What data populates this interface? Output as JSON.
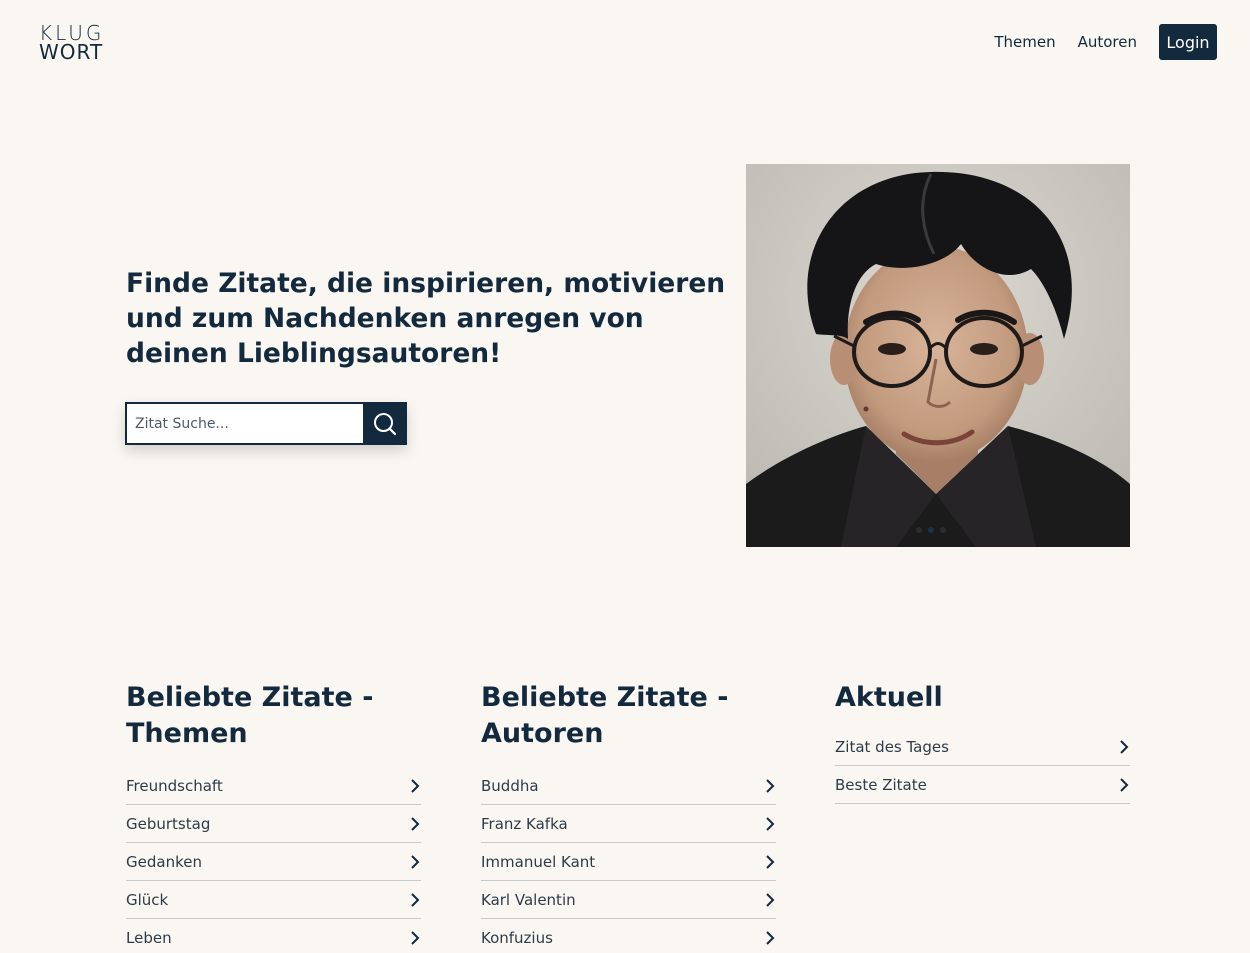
{
  "header": {
    "logo_line1": "KLUG",
    "logo_line2": "WORT",
    "nav": [
      "Themen",
      "Autoren"
    ],
    "login_label": "Login"
  },
  "hero": {
    "title": "Finde Zitate, die inspirieren, motivieren und zum Nachdenken anregen von deinen Lieblingsautoren!",
    "search_placeholder": "Zitat Suche...",
    "search_icon": "search-icon",
    "image": "author-portrait"
  },
  "columns": [
    {
      "heading": "Beliebte Zitate - Themen",
      "items": [
        "Freundschaft",
        "Geburtstag",
        "Gedanken",
        "Glück",
        "Leben"
      ]
    },
    {
      "heading": "Beliebte Zitate - Autoren",
      "items": [
        "Buddha",
        "Franz Kafka",
        "Immanuel Kant",
        "Karl Valentin",
        "Konfuzius"
      ]
    },
    {
      "heading": "Aktuell",
      "items": [
        "Zitat des Tages",
        "Beste Zitate"
      ]
    }
  ],
  "colors": {
    "primary": "#13293d",
    "background": "#faf7f3",
    "divider": "#c7c9cb"
  }
}
